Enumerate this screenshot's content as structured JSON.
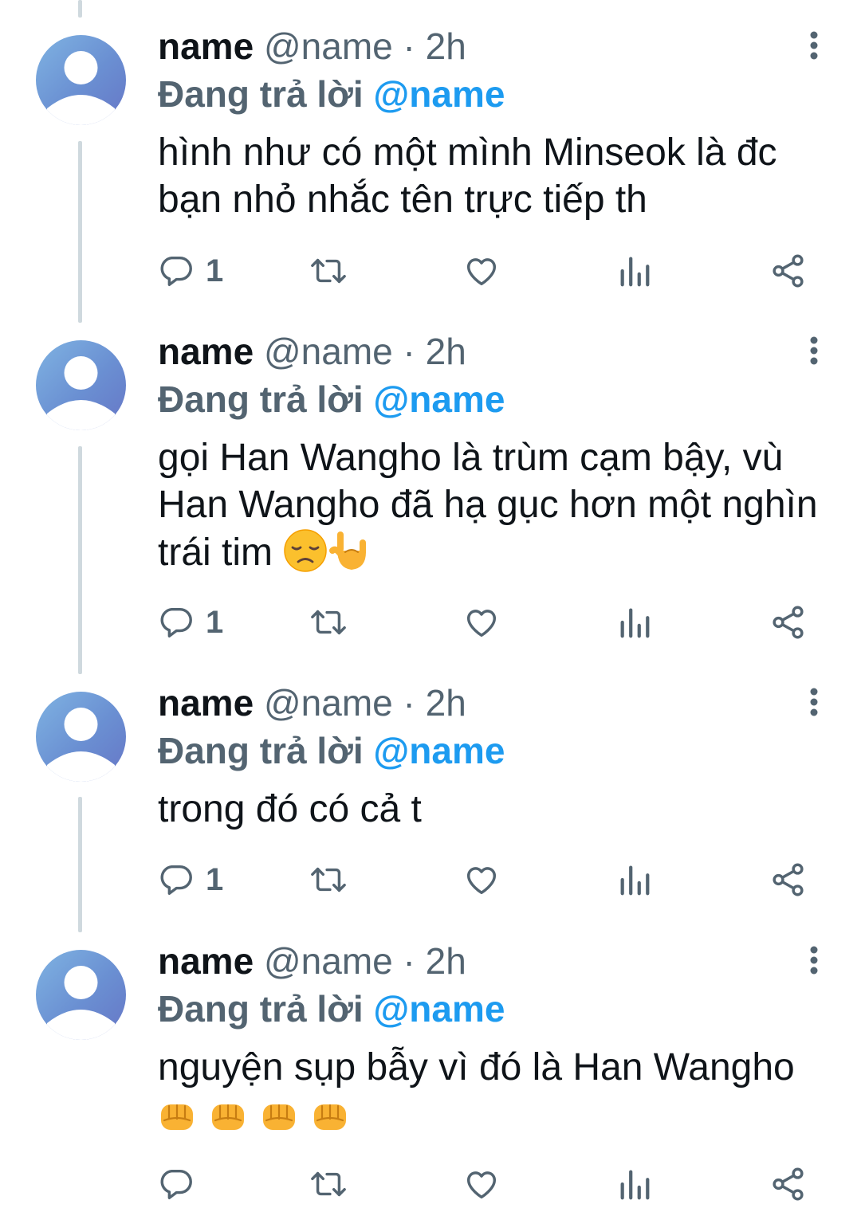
{
  "colors": {
    "text_primary": "#0f1419",
    "text_secondary": "#536471",
    "mention_blue": "#1d9bf0",
    "thread_line": "#cfd9de"
  },
  "icons": {
    "reply": "reply-icon",
    "retweet": "retweet-icon",
    "like": "heart-icon",
    "views": "analytics-icon",
    "share": "share-icon",
    "more": "more-vertical-icon"
  },
  "tweets": [
    {
      "name": "name",
      "handle": "@name",
      "separator": "·",
      "time": "2h",
      "reply_label": "Đang trả lời",
      "reply_to": "@name",
      "text": "hình như có một mình Minseok là đc bạn nhỏ nhắc tên trực tiếp th",
      "emojis": [],
      "reply_count": "1"
    },
    {
      "name": "name",
      "handle": "@name",
      "separator": "·",
      "time": "2h",
      "reply_label": "Đang trả lời",
      "reply_to": "@name",
      "text": "gọi Han Wangho là trùm cạm bậy, vù Han Wangho đã hạ gục hơn một nghìn trái tim",
      "emojis": [
        "disappointed-face",
        "love-you-gesture"
      ],
      "reply_count": "1"
    },
    {
      "name": "name",
      "handle": "@name",
      "separator": "·",
      "time": "2h",
      "reply_label": "Đang trả lời",
      "reply_to": "@name",
      "text": "trong đó có cả t",
      "emojis": [],
      "reply_count": "1"
    },
    {
      "name": "name",
      "handle": "@name",
      "separator": "·",
      "time": "2h",
      "reply_label": "Đang trả lời",
      "reply_to": "@name",
      "text": "nguyện sụp bẫy vì đó là Han Wangho",
      "emojis": [
        "oncoming-fist",
        "oncoming-fist",
        "oncoming-fist",
        "oncoming-fist"
      ],
      "reply_count": ""
    }
  ]
}
